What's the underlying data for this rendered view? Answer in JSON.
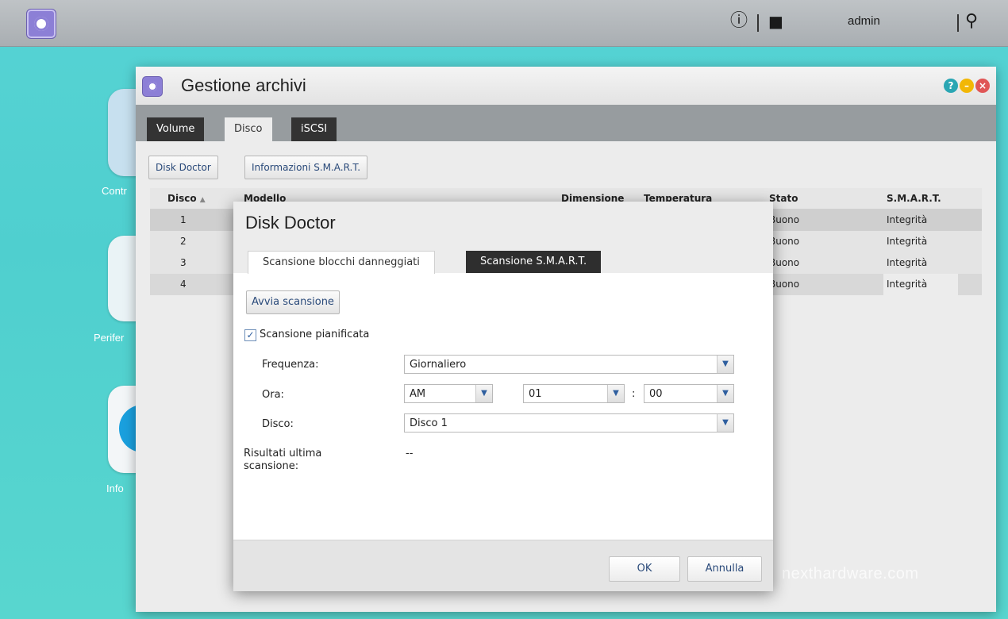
{
  "topbar": {
    "user": "admin",
    "info_icon": "info-icon",
    "user_icon": "user-icon",
    "search_icon": "search-icon"
  },
  "desktop": {
    "labels": [
      "Contr",
      "Perifer",
      "Info"
    ]
  },
  "window": {
    "title": "Gestione archivi",
    "tabs": [
      "Volume",
      "Disco",
      "iSCSI"
    ],
    "active_tab": "Disco",
    "toolbar": {
      "disk_doctor": "Disk Doctor",
      "smart_info": "Informazioni S.M.A.R.T."
    },
    "columns": [
      "Disco",
      "Modello",
      "Dimensione",
      "Temperatura",
      "Stato",
      "S.M.A.R.T."
    ],
    "sort_indicator": "▲",
    "rows": [
      {
        "disco": "1",
        "stato": "Buono",
        "smart": "Integrità"
      },
      {
        "disco": "2",
        "stato": "Buono",
        "smart": "Integrità"
      },
      {
        "disco": "3",
        "stato": "Buono",
        "smart": "Integrità"
      },
      {
        "disco": "4",
        "stato": "Buono",
        "smart": "Integrità"
      }
    ]
  },
  "dialog": {
    "title": "Disk Doctor",
    "tabs": [
      "Scansione blocchi danneggiati",
      "Scansione S.M.A.R.T."
    ],
    "start_scan": "Avvia scansione",
    "scheduled_label": "Scansione pianificata",
    "scheduled_checked": true,
    "frequency_label": "Frequenza:",
    "frequency_value": "Giornaliero",
    "time_label": "Ora:",
    "ampm_value": "AM",
    "hour_value": "01",
    "time_sep": ":",
    "minute_value": "00",
    "disk_label": "Disco:",
    "disk_value": "Disco 1",
    "last_results_label": "Risultati ultima scansione:",
    "last_results_value": "--",
    "ok": "OK",
    "cancel": "Annulla"
  },
  "watermark": "nexthardware.com",
  "colors": {
    "desktop": "#56d3d4",
    "app_icon": "#8c7fd6",
    "help": "#2aa6b3",
    "minimize": "#f2b705",
    "close": "#e05656"
  }
}
